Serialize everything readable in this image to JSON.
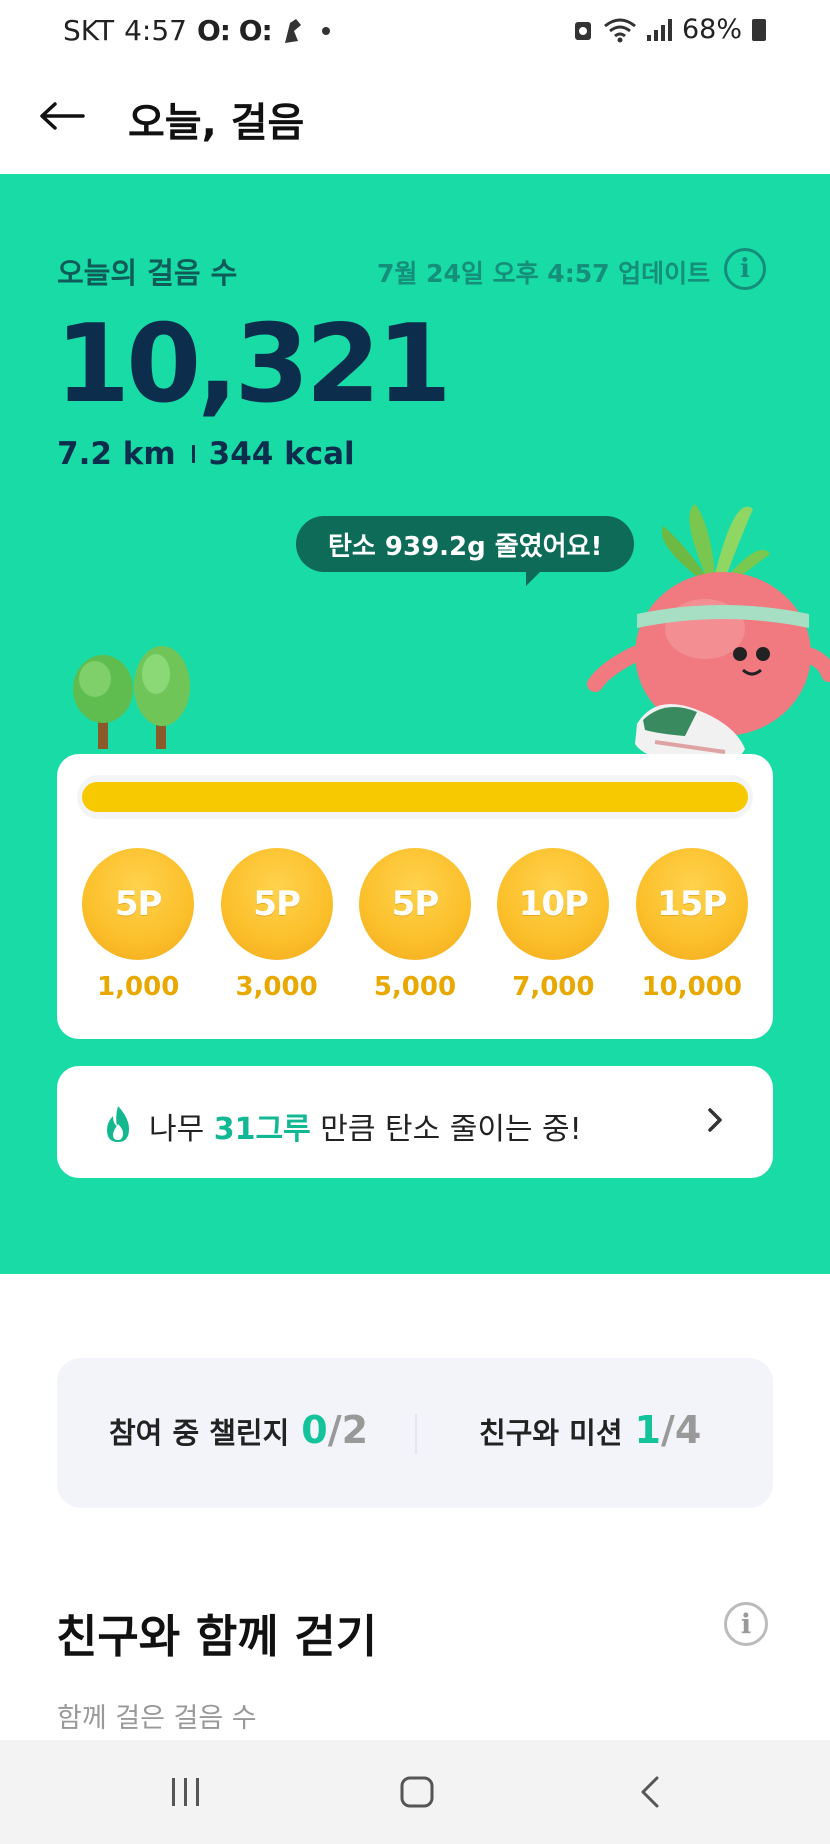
{
  "status_bar": {
    "carrier": "SKT",
    "time": "4:57",
    "notif_icons": "O: O:",
    "battery": "68%"
  },
  "header": {
    "back_icon": "back-arrow-icon",
    "title": "오늘, 걸음"
  },
  "hero": {
    "steps_label": "오늘의 걸음 수",
    "update_text": "7월 24일 오후 4:57 업데이트",
    "steps_value": "10,321",
    "distance": "7.2 km",
    "calories": "344 kcal",
    "carbon_message": "탄소 939.2g 줄였어요!",
    "colors": {
      "background": "#18dba6",
      "accent": "#0e6b58"
    }
  },
  "reward": {
    "progress_fraction": 1.0,
    "coins": [
      {
        "points": "5P",
        "steps": "1,000"
      },
      {
        "points": "5P",
        "steps": "3,000"
      },
      {
        "points": "5P",
        "steps": "5,000"
      },
      {
        "points": "10P",
        "steps": "7,000"
      },
      {
        "points": "15P",
        "steps": "10,000"
      }
    ]
  },
  "tree_banner": {
    "prefix": "나무",
    "highlight": "31그루",
    "suffix": "만큼 탄소 줄이는 중!"
  },
  "challenges": {
    "challenge_label": "참여 중 챌린지",
    "challenge_done": "0",
    "challenge_total": "/2",
    "mission_label": "친구와 미션",
    "mission_done": "1",
    "mission_total": "/4"
  },
  "friends": {
    "title": "친구와 함께 걷기",
    "subtitle": "함께 걸은 걸음 수"
  }
}
